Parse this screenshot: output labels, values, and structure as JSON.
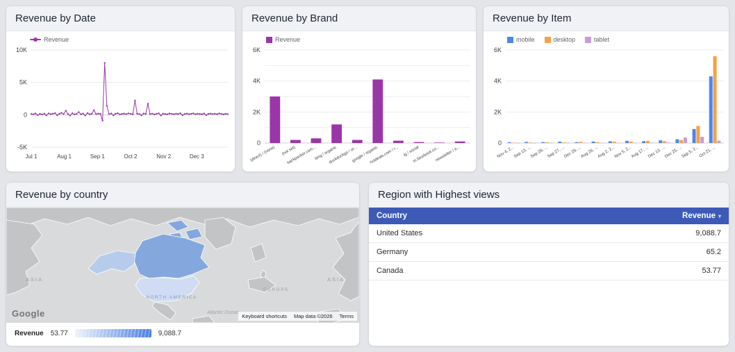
{
  "colors": {
    "purple": "#9a36a8",
    "mobile_blue": "#4e85f2",
    "desktop_orange": "#f5a142",
    "tablet_purple": "#c59bdb",
    "table_header_blue": "#3d5ab7",
    "map_water": "#d8dadc",
    "map_land": "#c2c4c6",
    "map_canada": "#84a8dd",
    "map_alaska": "#b7cceb",
    "map_united_states": "#cfdcf4"
  },
  "chart_data": [
    {
      "type": "line",
      "title": "Revenue by Date",
      "ylim": [
        -5000,
        10000
      ],
      "yticks": [
        {
          "v": -5000,
          "l": "-5K"
        },
        {
          "v": 0,
          "l": "0"
        },
        {
          "v": 5000,
          "l": "5K"
        },
        {
          "v": 10000,
          "l": "10K"
        }
      ],
      "xticks": [
        {
          "p": 0.0,
          "l": "Jul 1"
        },
        {
          "p": 0.168,
          "l": "Aug 1"
        },
        {
          "p": 0.337,
          "l": "Sep 1"
        },
        {
          "p": 0.505,
          "l": "Oct 2"
        },
        {
          "p": 0.674,
          "l": "Nov 2"
        },
        {
          "p": 0.842,
          "l": "Dec 3"
        }
      ],
      "series": [
        {
          "name": "Revenue",
          "color": "#9a36a8",
          "values": [
            120,
            80,
            200,
            -60,
            150,
            60,
            180,
            -90,
            220,
            100,
            160,
            250,
            -70,
            140,
            300,
            110,
            640,
            90,
            -120,
            230,
            60,
            150,
            420,
            80,
            190,
            -100,
            260,
            90,
            150,
            700,
            110,
            180,
            140,
            -900,
            8000,
            1400,
            120,
            200,
            -90,
            160,
            240,
            70,
            130,
            180,
            100,
            220,
            150,
            80,
            2200,
            170,
            120,
            -90,
            200,
            140,
            1700,
            110,
            180,
            60,
            150,
            230,
            -100,
            170,
            120,
            80,
            200,
            150,
            90,
            160,
            110,
            240,
            -70,
            130,
            190,
            100,
            150,
            220,
            80,
            170,
            120,
            90,
            200,
            -60,
            140,
            180,
            110,
            160,
            90,
            210,
            130,
            70,
            150,
            100
          ]
        }
      ]
    },
    {
      "type": "bar",
      "title": "Revenue by Brand",
      "legend": "Revenue",
      "color": "#9a36a8",
      "ylim": [
        0,
        6000
      ],
      "grid_step": 1000,
      "yticks": [
        {
          "v": 0,
          "l": "0"
        },
        {
          "v": 2000,
          "l": "2K"
        },
        {
          "v": 4000,
          "l": "4K"
        },
        {
          "v": 6000,
          "l": "6K"
        }
      ],
      "categories": [
        "(direct) / (none)",
        "(not set)",
        "backpacker.com...",
        "bing / organic",
        "duckduckgo / or...",
        "google / organic",
        "hotdeals.com / r...",
        "ig / social",
        "m.facebook.co...",
        "newsletter / e..."
      ],
      "values": [
        3000,
        200,
        300,
        1200,
        200,
        4100,
        150,
        60,
        30,
        100
      ]
    },
    {
      "type": "grouped_bar",
      "title": "Revenue by Item",
      "ylim": [
        0,
        6000
      ],
      "grid_step": 2000,
      "yticks": [
        {
          "v": 0,
          "l": "0"
        },
        {
          "v": 2000,
          "l": "2K"
        },
        {
          "v": 4000,
          "l": "4K"
        },
        {
          "v": 6000,
          "l": "6K"
        }
      ],
      "categories": [
        "Nov 4, 2...",
        "Sep 13, ...",
        "Sep 28, ...",
        "Sep 27, ...",
        "Dec 29, ...",
        "Aug 26, ...",
        "Aug 2, 2...",
        "Nov 5, 2...",
        "Aug 17, ...",
        "Dec 13, ...",
        "Dec 25, ...",
        "Sep 5, 2...",
        "Oct 21, ..."
      ],
      "series": [
        {
          "name": "mobile",
          "color": "#4e85f2",
          "values": [
            50,
            70,
            60,
            90,
            55,
            95,
            110,
            140,
            120,
            170,
            240,
            900,
            4300
          ]
        },
        {
          "name": "desktop",
          "color": "#f5a142",
          "values": [
            25,
            35,
            45,
            40,
            75,
            55,
            85,
            95,
            140,
            115,
            190,
            1100,
            5600
          ]
        },
        {
          "name": "tablet",
          "color": "#c59bdb",
          "values": [
            8,
            10,
            14,
            10,
            18,
            14,
            18,
            22,
            28,
            38,
            350,
            400,
            150
          ]
        }
      ]
    },
    {
      "type": "geo",
      "title": "Revenue by country",
      "logo": "Google",
      "map_labels": {
        "asia_left": "ASIA",
        "asia_right": "ASIA",
        "north_america": "NORTH AMERICA",
        "europe": "EUROPE",
        "atlantic": "Atlantic Ocean"
      },
      "attribution": {
        "shortcuts": "Keyboard shortcuts",
        "map_data": "Map data ©2026",
        "terms": "Terms"
      },
      "legend": {
        "label": "Revenue",
        "min": "53.77",
        "max": "9,088.7"
      },
      "countries": [
        {
          "name": "United States",
          "value": 9088.7
        },
        {
          "name": "Germany",
          "value": 65.2
        },
        {
          "name": "Canada",
          "value": 53.77
        }
      ]
    },
    {
      "type": "table",
      "title": "Region with Highest views",
      "columns": [
        "Country",
        "Revenue"
      ],
      "sort_indicator": "▾",
      "rows": [
        [
          "United States",
          "9,088.7"
        ],
        [
          "Germany",
          "65.2"
        ],
        [
          "Canada",
          "53.77"
        ]
      ]
    }
  ]
}
